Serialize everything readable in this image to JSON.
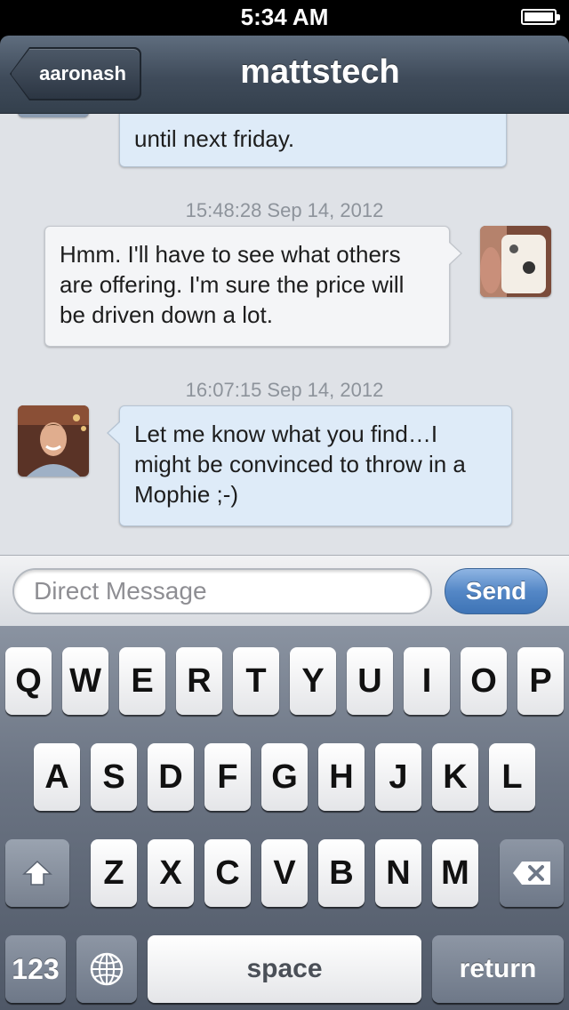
{
  "status_bar": {
    "time": "5:34 AM"
  },
  "nav": {
    "back_label": "aaronash",
    "title": "mattstech"
  },
  "messages": [
    {
      "sender": "them",
      "text": "until next friday."
    },
    {
      "timestamp": "15:48:28 Sep 14, 2012",
      "sender": "me",
      "text": "Hmm. I'll have to see what others are offering. I'm sure the price will be driven down a lot."
    },
    {
      "timestamp": "16:07:15 Sep 14, 2012",
      "sender": "them",
      "text": "Let me know what you find…I might be convinced to throw in a Mophie ;-)"
    }
  ],
  "compose": {
    "placeholder": "Direct Message",
    "send_label": "Send"
  },
  "keyboard": {
    "row1": [
      "Q",
      "W",
      "E",
      "R",
      "T",
      "Y",
      "U",
      "I",
      "O",
      "P"
    ],
    "row2": [
      "A",
      "S",
      "D",
      "F",
      "G",
      "H",
      "J",
      "K",
      "L"
    ],
    "row3": [
      "Z",
      "X",
      "C",
      "V",
      "B",
      "N",
      "M"
    ],
    "numbers_label": "123",
    "space_label": "space",
    "return_label": "return"
  },
  "colors": {
    "bubble_them": "#deebf8",
    "bubble_me": "#f4f5f7",
    "send_button": "#5487c6",
    "nav_bar": "#3f4b5a"
  }
}
